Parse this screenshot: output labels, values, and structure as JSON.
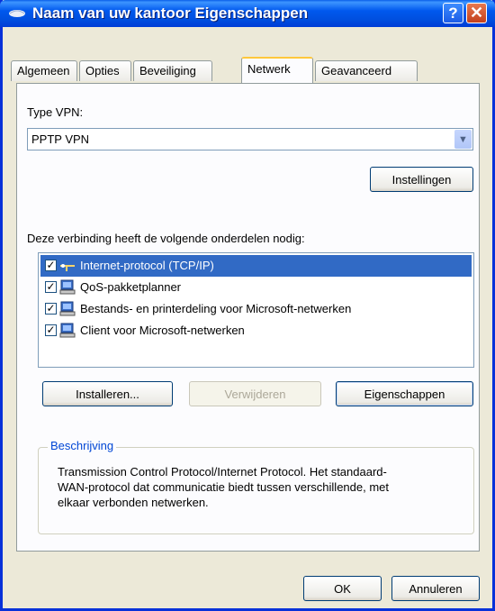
{
  "window": {
    "title": "Naam van uw kantoor Eigenschappen",
    "help_glyph": "?",
    "close_glyph": "✕"
  },
  "tabs": [
    {
      "label": "Algemeen"
    },
    {
      "label": "Opties"
    },
    {
      "label": "Beveiliging"
    },
    {
      "label": "Netwerk",
      "active": true
    },
    {
      "label": "Geavanceerd"
    }
  ],
  "vpn": {
    "type_label": "Type VPN:",
    "selected": "PPTP VPN",
    "settings_button": "Instellingen"
  },
  "components": {
    "heading": "Deze verbinding heeft de volgende onderdelen nodig:",
    "items": [
      {
        "label": "Internet-protocol (TCP/IP)",
        "checked": true,
        "selected": true,
        "icon": "protocol-icon"
      },
      {
        "label": "QoS-pakketplanner",
        "checked": true,
        "selected": false,
        "icon": "network-service-icon"
      },
      {
        "label": "Bestands- en printerdeling voor Microsoft-netwerken",
        "checked": true,
        "selected": false,
        "icon": "network-service-icon"
      },
      {
        "label": "Client voor Microsoft-netwerken",
        "checked": true,
        "selected": false,
        "icon": "network-client-icon"
      }
    ]
  },
  "actions": {
    "install": "Installeren...",
    "remove": "Verwijderen",
    "properties": "Eigenschappen"
  },
  "description": {
    "title": "Beschrijving",
    "text": "Transmission Control Protocol/Internet Protocol. Het standaard-WAN-protocol dat communicatie biedt tussen verschillende, met elkaar verbonden netwerken."
  },
  "footer": {
    "ok": "OK",
    "cancel": "Annuleren"
  },
  "colors": {
    "titlebar": "#0058ee",
    "selection": "#316ac5",
    "group_title": "#0046d5",
    "active_tab_highlight": "#ffc83c"
  }
}
